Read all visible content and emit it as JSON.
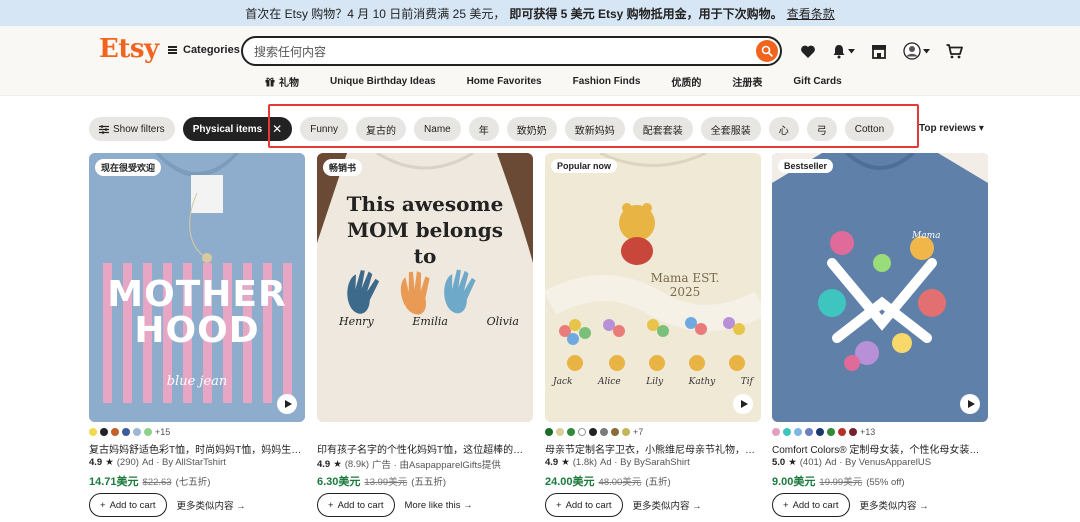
{
  "promo": {
    "part1": "首次在 Etsy 购物？4 月 10 日前消费满 25 美元，",
    "part2": "即可获得 5 美元 Etsy 购物抵用金，用于下次购物。",
    "link": "查看条款"
  },
  "header": {
    "logo": "Etsy",
    "categories_label": "Categories",
    "search_placeholder": "搜索任何内容"
  },
  "nav": [
    "礼物",
    "Unique Birthday Ideas",
    "Home Favorites",
    "Fashion Finds",
    "优质的",
    "注册表",
    "Gift Cards"
  ],
  "filters": {
    "show_filters": "Show filters",
    "physical_items": "Physical items",
    "chips": [
      "Funny",
      "复古的",
      "Name",
      "年",
      "致奶奶",
      "致新妈妈",
      "配套套装",
      "全套服装",
      "心",
      "弓",
      "Cotton"
    ],
    "sort": "Top reviews"
  },
  "products": [
    {
      "badge": "现在很受欢迎",
      "image_text": "MOTHER HOOD",
      "swatch_colors": [
        "#f0d94a",
        "#222222",
        "#c0622a",
        "#3d5a9a",
        "#9bb8d6",
        "#8fd18a"
      ],
      "more_colors": "+15",
      "title": "复古妈妈舒适色彩T恤，时尚妈妈T恤，妈妈生活T恤…",
      "rating": "4.9",
      "reviews": "(290)",
      "ad": "Ad · By AllStarTshirt",
      "price": "14.71美元",
      "was": "$22.63",
      "off": "(七五折)",
      "add_to_cart": "Add to cart",
      "more_like": "更多类似内容 →"
    },
    {
      "badge": "畅销书",
      "image_text": "This awesome MOM belongs to",
      "names": [
        "Henry",
        "Emilia",
        "Olivia"
      ],
      "swatch_colors": [],
      "more_colors": "",
      "title": "印有孩子名字的个性化妈妈T恤，这位超棒的妈妈属…",
      "rating": "4.9",
      "reviews": "(8.9k)",
      "ad": "广告 · 由AsapapparelGifts提供",
      "price": "6.30美元",
      "was": "13.99美元",
      "off": "(五五折)",
      "add_to_cart": "Add to cart",
      "more_like": "More like this →"
    },
    {
      "badge": "Popular now",
      "image_text": "Mama EST. 2025",
      "names": [
        "Jack",
        "Alice",
        "Lily",
        "Kathy",
        "Tif"
      ],
      "swatch_colors": [
        "#1b6b2a",
        "#d9cf9a",
        "#2f8a3a",
        "#ffffff",
        "#222222",
        "#7a7a7a",
        "#8a6b3a",
        "#c7b35a"
      ],
      "more_colors": "+7",
      "title": "母亲节定制名字卫衣，小熊维尼母亲节礼物，定制\"…",
      "rating": "4.9",
      "reviews": "(1.8k)",
      "ad": "Ad · By BySarahShirt",
      "price": "24.00美元",
      "was": "48.00美元",
      "off": "(五折)",
      "add_to_cart": "Add to cart",
      "more_like": "更多类似内容 →"
    },
    {
      "badge": "Bestseller",
      "image_text": "Mama",
      "swatch_colors": [
        "#e2a0c0",
        "#3ec5c0",
        "#7fb6e3",
        "#6a7fbf",
        "#1b3a6b",
        "#2f8a3a",
        "#b5322a",
        "#7a1f2a"
      ],
      "more_colors": "+13",
      "title": "Comfort Colors® 定制母女装，个性化母女装，拉钩…",
      "rating": "5.0",
      "reviews": "(401)",
      "ad": "Ad · By VenusApparelUS",
      "price": "9.00美元",
      "was": "19.99美元",
      "off": "(55% off)",
      "add_to_cart": "Add to cart",
      "more_like": "更多类似内容 →"
    }
  ]
}
